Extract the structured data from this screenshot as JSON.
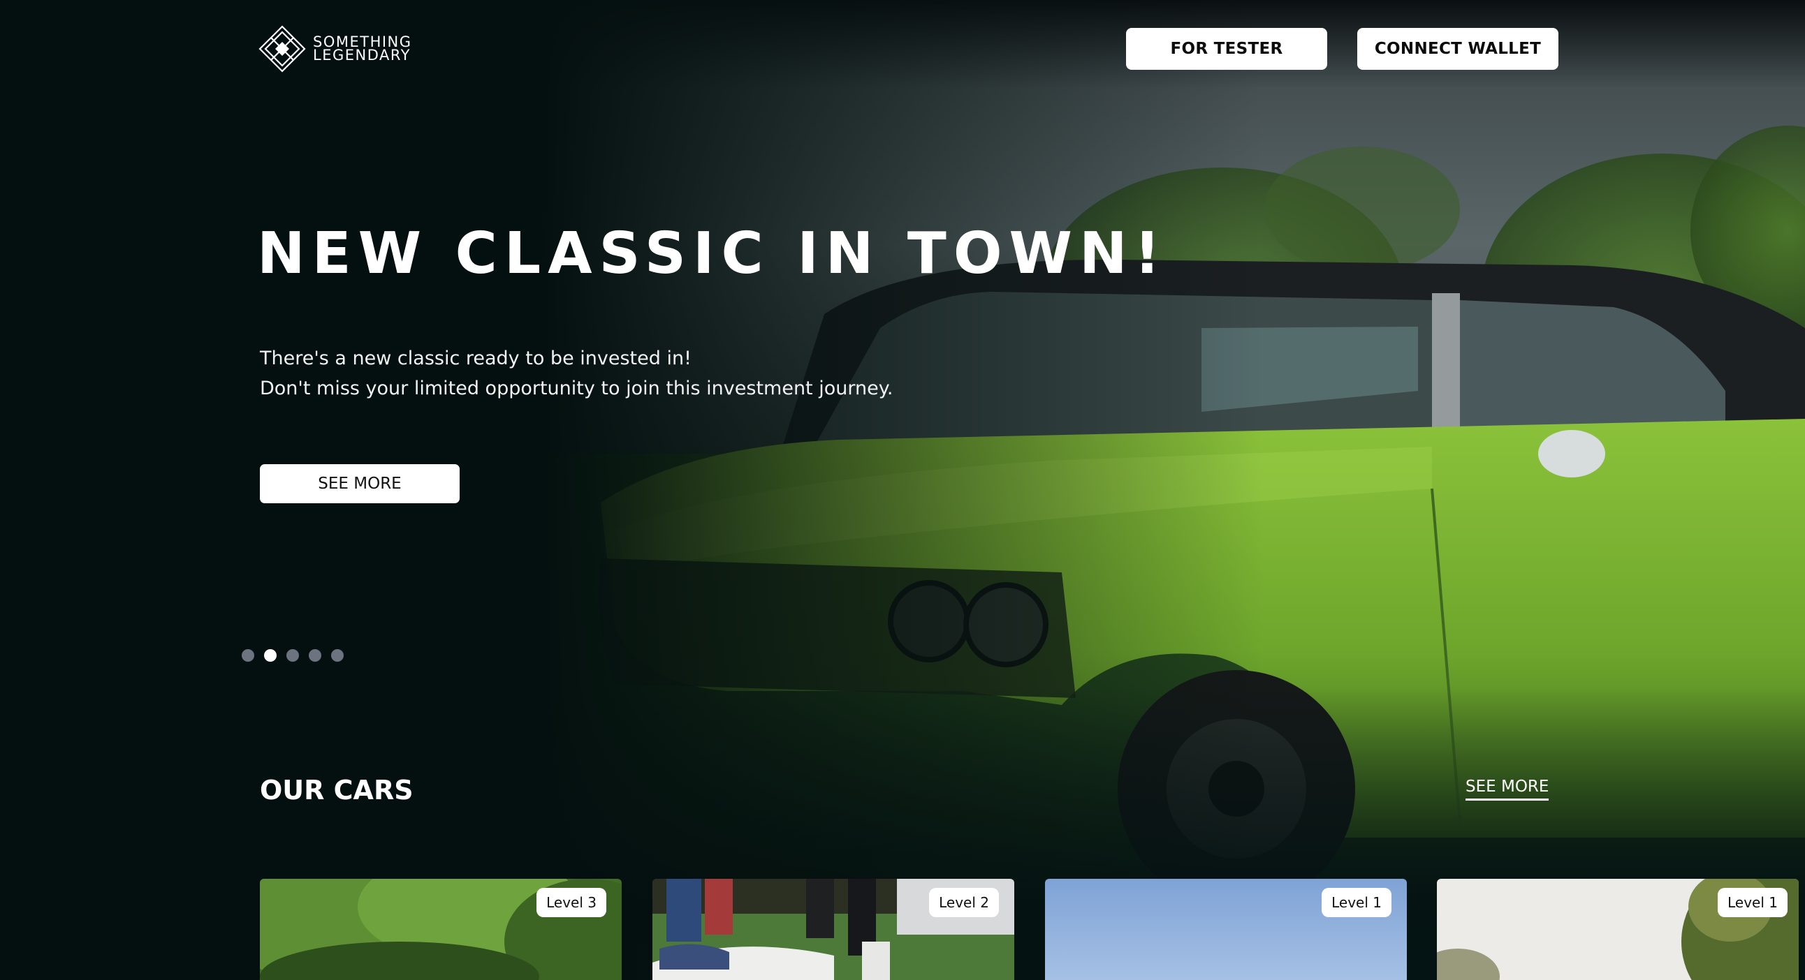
{
  "header": {
    "logo_line1": "SOMETHING",
    "logo_line2": "LEGENDARY",
    "tester_label": "FOR TESTER",
    "wallet_label": "CONNECT WALLET"
  },
  "hero": {
    "title": "NEW CLASSIC IN TOWN!",
    "subtitle_line1": "There's a new classic ready to be invested in!",
    "subtitle_line2": "Don't miss your limited opportunity to join this investment journey.",
    "cta_label": "SEE MORE",
    "slide_count": 5,
    "active_slide": 2
  },
  "cars_section": {
    "title": "OUR CARS",
    "see_more_label": "SEE MORE",
    "cards": [
      {
        "level": "Level 3"
      },
      {
        "level": "Level 2"
      },
      {
        "level": "Level 1"
      },
      {
        "level": "Level 1"
      }
    ]
  },
  "colors": {
    "background": "#05100f",
    "button_bg": "#ffffff",
    "button_text": "#0c0c0c",
    "car_green": "#7fb533",
    "dot_inactive": "#6d7480",
    "dot_active": "#ffffff"
  }
}
